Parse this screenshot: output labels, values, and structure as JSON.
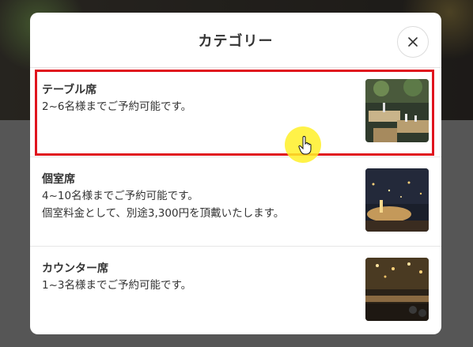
{
  "modal": {
    "title": "カテゴリー",
    "close_icon": "close-icon"
  },
  "categories": [
    {
      "title": "テーブル席",
      "lines": [
        "2~6名様までご予約可能です。"
      ],
      "image": "restaurant-table-seating-photo",
      "highlighted": true
    },
    {
      "title": "個室席",
      "lines": [
        "4~10名様までご予約可能です。",
        "個室料金として、別途3,300円を頂戴いたします。"
      ],
      "image": "private-room-night-view-photo",
      "highlighted": false
    },
    {
      "title": "カウンター席",
      "lines": [
        "1~3名様までご予約可能です。"
      ],
      "image": "bar-counter-photo",
      "highlighted": false
    }
  ],
  "colors": {
    "highlight_border": "#e0141e",
    "cursor_highlight": "#fff028"
  }
}
